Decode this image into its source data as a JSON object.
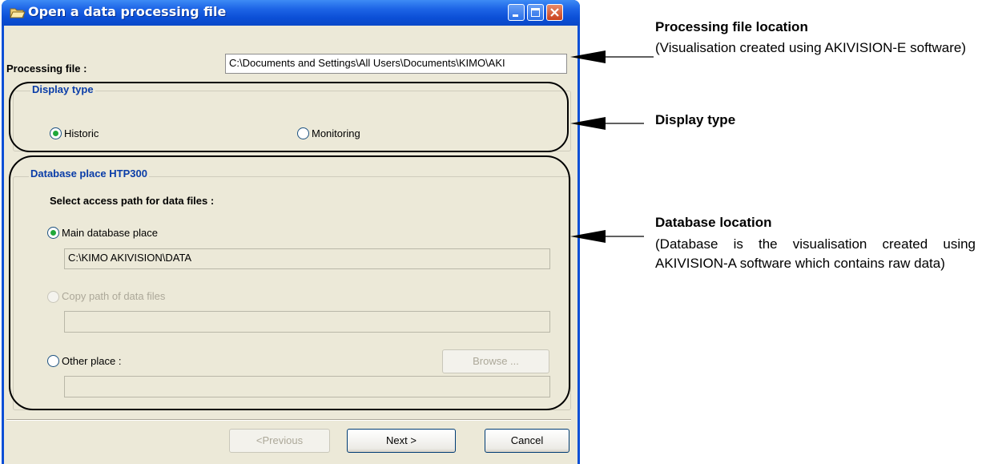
{
  "window": {
    "title": "Open a data processing file"
  },
  "processing_file": {
    "label": "Processing file :",
    "value": "C:\\Documents and Settings\\All Users\\Documents\\KIMO\\AKI"
  },
  "display_type": {
    "legend": "Display type",
    "options": [
      {
        "label": "Historic",
        "selected": true
      },
      {
        "label": "Monitoring",
        "selected": false
      }
    ]
  },
  "database": {
    "legend": "Database place HTP300",
    "subheading": "Select access path for data files :",
    "main": {
      "label": "Main database place",
      "selected": true,
      "path": "C:\\KIMO AKIVISION\\DATA"
    },
    "copy": {
      "label": "Copy path of data files",
      "selected": false,
      "enabled": false,
      "path": ""
    },
    "other": {
      "label": "Other place :",
      "selected": false,
      "path": "",
      "browse_label": "Browse ..."
    }
  },
  "buttons": {
    "previous": "<Previous",
    "next": "Next >",
    "cancel": "Cancel"
  },
  "annotations": {
    "processing_file": {
      "title": "Processing file location",
      "text": "(Visualisation created using AKIVISION-E software)"
    },
    "display_type": {
      "title": "Display type"
    },
    "database": {
      "title": "Database location",
      "text": "(Database is the visualisation created using AKIVISION-A software which contains raw data)"
    }
  },
  "colors": {
    "titlebar": "#0a4fd6",
    "dialog_bg": "#ece9d8",
    "group_legend": "#0a3da8",
    "radio_dot": "#20a83a"
  }
}
